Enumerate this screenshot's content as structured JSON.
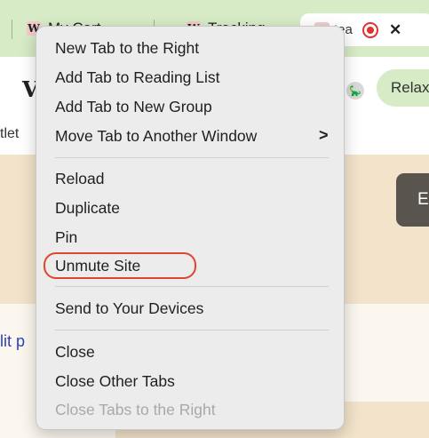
{
  "tabs": {
    "tab1": {
      "favicon": "W",
      "title": "My Cart"
    },
    "tab2": {
      "favicon": "W",
      "title": "Tracking"
    },
    "active": {
      "favicon": "W",
      "title": "tea"
    }
  },
  "toolbar": {
    "left_char": "V",
    "relax_label": "Relax"
  },
  "bookmarks": {
    "text": "tlet"
  },
  "page": {
    "button_char": "E",
    "link_text": "lit p"
  },
  "menu": {
    "new_tab_right": "New Tab to the Right",
    "add_reading_list": "Add Tab to Reading List",
    "add_new_group": "Add Tab to New Group",
    "move_window": "Move Tab to Another Window",
    "move_arrow": ">",
    "reload": "Reload",
    "duplicate": "Duplicate",
    "pin": "Pin",
    "unmute_site": "Unmute Site",
    "send_devices": "Send to Your Devices",
    "close": "Close",
    "close_other": "Close Other Tabs",
    "close_right": "Close Tabs to the Right"
  },
  "colors": {
    "tabstrip_green": "#d7ebc7",
    "highlight_red": "#e0452e",
    "record_red": "#e0322f"
  },
  "icons": {
    "record": "record-icon",
    "close": "close-icon",
    "extension": "dino-icon"
  }
}
